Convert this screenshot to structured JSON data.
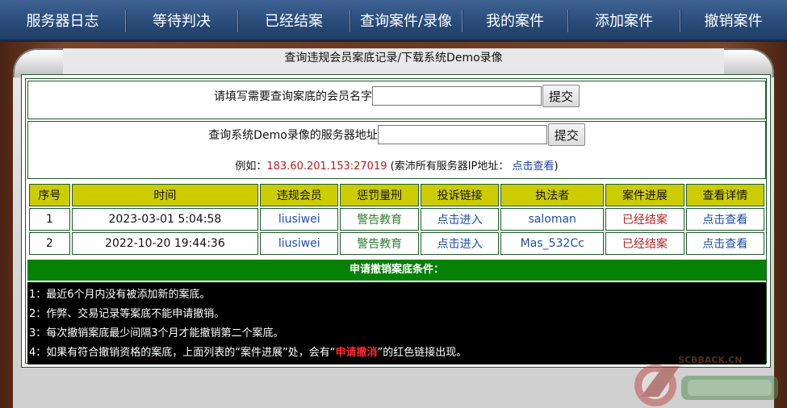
{
  "nav": {
    "items": [
      "服务器日志",
      "等待判决",
      "已经结案",
      "查询案件/录像",
      "我的案件",
      "添加案件",
      "撤销案件"
    ]
  },
  "page": {
    "title": "查询违规会员案底记录/下载系统Demo录像"
  },
  "form1": {
    "label": "请填写需要查询案底的会员名字",
    "value": "",
    "button": "提交"
  },
  "form2": {
    "label": "查询系统Demo录像的服务器地址",
    "value": "",
    "button": "提交"
  },
  "example": {
    "prefix": "例如：",
    "ip": "183.60.201.153:27019",
    "middle": "(索沛所有服务器IP地址：",
    "link": "点击查看",
    "suffix": ")"
  },
  "table": {
    "headers": [
      "序号",
      "时间",
      "违规会员",
      "惩罚量刑",
      "投诉链接",
      "执法者",
      "案件进展",
      "查看详情"
    ],
    "rows": [
      [
        "1",
        "2023-03-01 5:04:58",
        "liusiwei",
        "警告教育",
        "点击进入",
        "saloman",
        "已经结案",
        "点击查看"
      ],
      [
        "2",
        "2022-10-20 19:44:36",
        "liusiwei",
        "警告教育",
        "点击进入",
        "Mas_532Cc",
        "已经结案",
        "点击查看"
      ]
    ]
  },
  "rules": {
    "heading": "申请撤销案底条件：",
    "lines": [
      "1：最近6个月内没有被添加新的案底。",
      "2：作弊、交易记录等案底不能申请撤销。",
      "3：每次撤销案底最少间隔3个月才能撤销第二个案底。"
    ],
    "line4_prefix": "4：如果有符合撤销资格的案底，上面列表的“案件进展”处，会有“",
    "line4_highlight": "申请撤消",
    "line4_suffix": "”的红色链接出现。"
  },
  "watermark": {
    "site": "SCBBACK.CN"
  },
  "colors": {
    "nav": "#2c4f7e",
    "header_cell": "#cccc00",
    "rules_head": "#058205",
    "status_red": "#b22222",
    "link_blue": "#1f4fa8",
    "penalty_green": "#2f7d2f"
  }
}
